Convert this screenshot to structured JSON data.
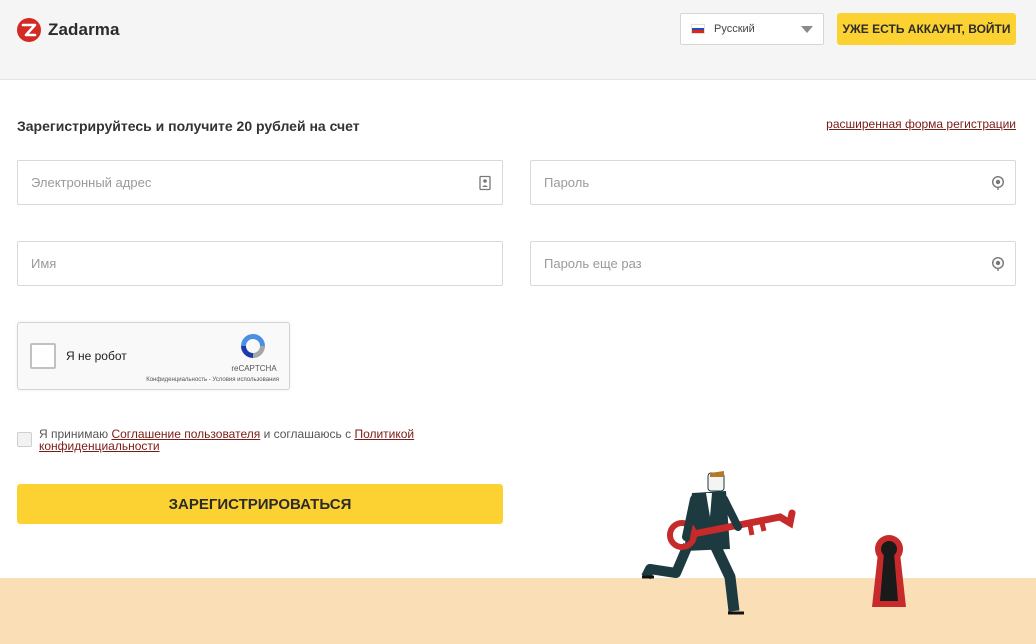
{
  "header": {
    "brand": "Zadarma",
    "language": {
      "selected": "Русский"
    },
    "login_button": "УЖЕ ЕСТЬ АККАУНТ, ВОЙТИ"
  },
  "form": {
    "title": "Зарегистрируйтесь и получите 20 рублей на счет",
    "advanced_link": "расширенная форма регистрации",
    "email": {
      "placeholder": "Электронный адрес",
      "value": ""
    },
    "password": {
      "placeholder": "Пароль",
      "value": ""
    },
    "name": {
      "placeholder": "Имя",
      "value": ""
    },
    "password_repeat": {
      "placeholder": "Пароль еще раз",
      "value": ""
    },
    "recaptcha": {
      "label": "Я не робот",
      "brand": "reCAPTCHA",
      "links": "Конфиденциальность - Условия использования"
    },
    "agreement": {
      "text_before": "Я принимаю ",
      "user_agreement_link": "Соглашение пользователя",
      "text_middle": " и соглашаюсь с ",
      "privacy_link": "Политикой конфиденциальности"
    },
    "submit_button": "ЗАРЕГИСТРИРОВАТЬСЯ"
  },
  "colors": {
    "accent": "#fcd232",
    "brand_red": "#d42a24",
    "link": "#7a1c16",
    "ground": "#f9deb6"
  },
  "icons": {
    "email": "contact-card-icon",
    "password": "eye-icon",
    "recaptcha": "recaptcha-logo-icon"
  }
}
